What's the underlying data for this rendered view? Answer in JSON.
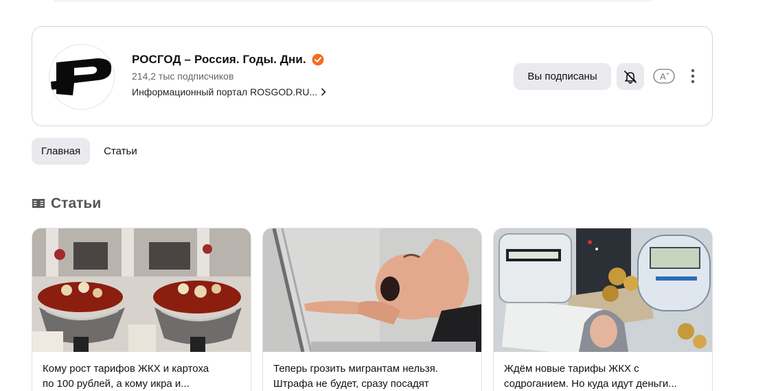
{
  "channel": {
    "title": "РОСГОД – Россия. Годы. Дни.",
    "subscribers": "214,2 тыс подписчиков",
    "description": "Информационный портал ROSGOD.RU...",
    "verified_color": "#f36c21"
  },
  "actions": {
    "subscribed_label": "Вы подписаны",
    "font_icon_label": "A+"
  },
  "tabs": [
    {
      "label": "Главная",
      "active": true
    },
    {
      "label": "Статьи",
      "active": false
    }
  ],
  "section": {
    "title": "Статьи",
    "icon": "article-icon"
  },
  "articles": [
    {
      "title_line1": "Кому рост тарифов ЖКХ и картоха",
      "title_line2": "по 100 рублей, а кому икра и..."
    },
    {
      "title_line1": "Теперь грозить мигрантам нельзя.",
      "title_line2": "Штрафа не будет, сразу посадят"
    },
    {
      "title_line1": "Ждём новые тарифы ЖКХ с",
      "title_line2": "содроганием. Но куда идут деньги..."
    }
  ]
}
